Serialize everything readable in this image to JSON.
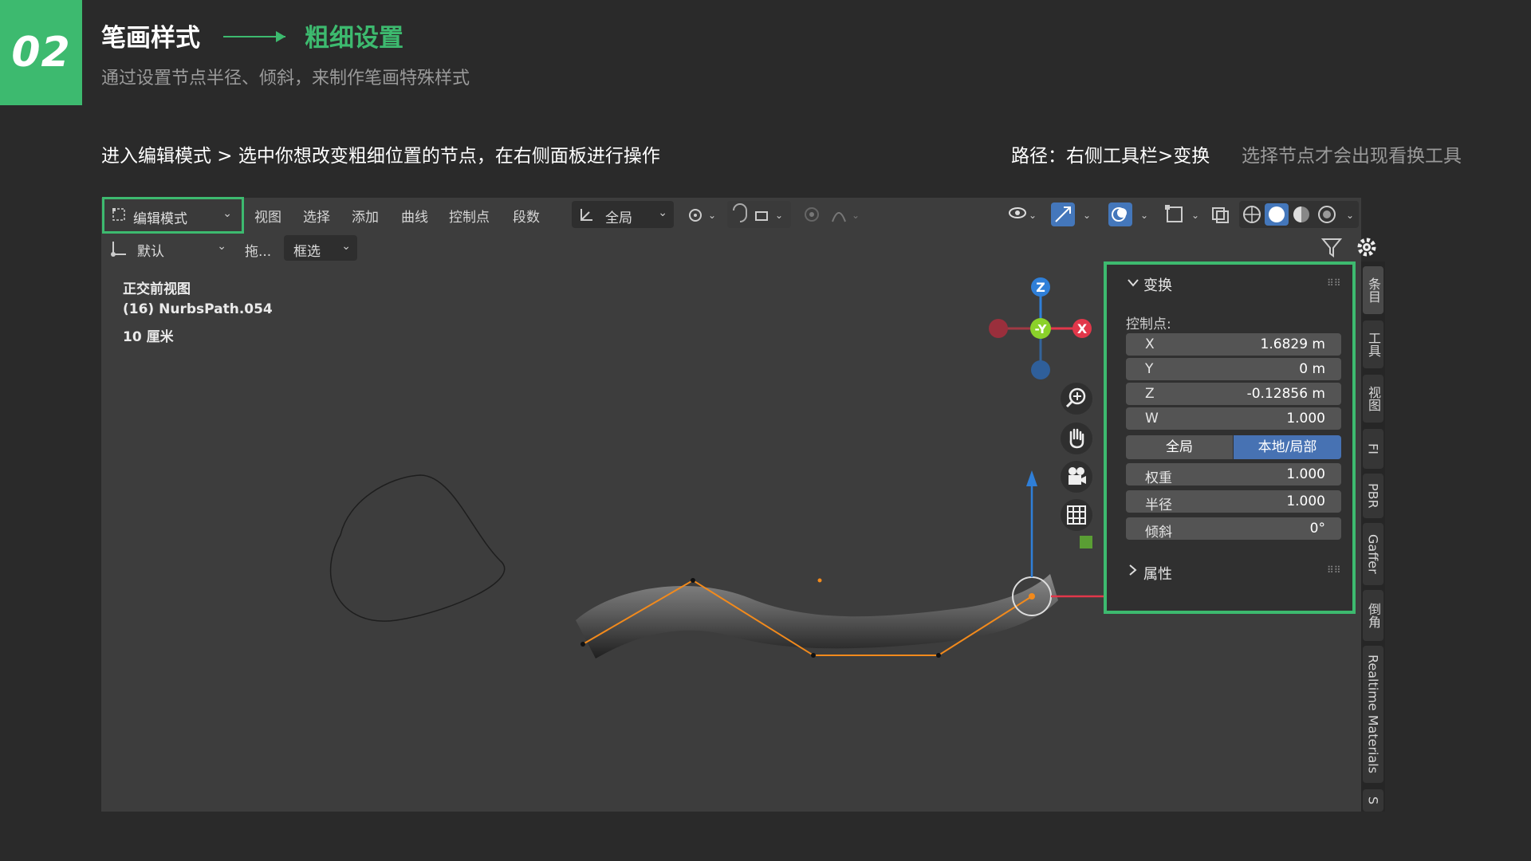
{
  "header": {
    "number": "02",
    "title": "笔画样式",
    "title_highlight": "粗细设置",
    "subtitle": "通过设置节点半径、倾斜，来制作笔画特殊样式",
    "step_text": "进入编辑模式 > 选中你想改变粗细位置的节点，在右侧面板进行操作",
    "path_text": "路径：右侧工具栏>变换",
    "note_text": "选择节点才会出现看换工具"
  },
  "toolbar": {
    "mode": "编辑模式",
    "menus": [
      "视图",
      "选择",
      "添加",
      "曲线",
      "控制点",
      "段数"
    ],
    "orientation": "全局",
    "pivot": "默认",
    "drag": "拖...",
    "select_mode": "框选"
  },
  "hud": {
    "view_name": "正交前视图",
    "object": "(16) NurbsPath.054",
    "scale": "10 厘米"
  },
  "gizmo": {
    "z": "Z",
    "y": "-Y",
    "x": "X"
  },
  "npanel": {
    "transform_title": "变换",
    "control_point_label": "控制点:",
    "fields": [
      {
        "key": "X",
        "value": "1.6829 m"
      },
      {
        "key": "Y",
        "value": "0 m"
      },
      {
        "key": "Z",
        "value": "-0.12856 m"
      },
      {
        "key": "W",
        "value": "1.000"
      }
    ],
    "toggle_global": "全局",
    "toggle_local": "本地/局部",
    "weight_label": "权重",
    "weight_value": "1.000",
    "radius_label": "半径",
    "radius_value": "1.000",
    "tilt_label": "倾斜",
    "tilt_value": "0°",
    "properties_title": "属性"
  },
  "side_tabs": [
    "条目",
    "工具",
    "视图",
    "FI",
    "PBR",
    "Gaffer",
    "倒角",
    "Realtime Materials",
    "S"
  ],
  "colors": {
    "accent": "#3dba6f",
    "x_axis": "#e2374a",
    "y_axis": "#8bd12a",
    "z_axis": "#2f7fd8",
    "selection": "#f28a1c"
  }
}
